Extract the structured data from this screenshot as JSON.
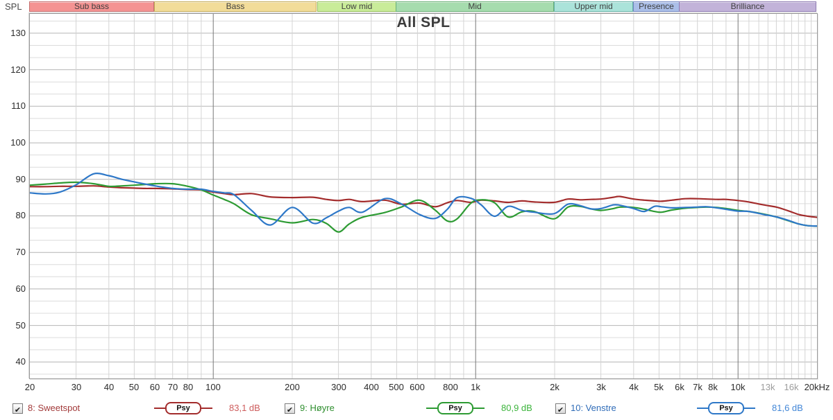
{
  "window": {
    "y_axis_corner_label": "SPL",
    "title": "All SPL"
  },
  "bands": {
    "items": [
      {
        "label": "Sub bass",
        "from": 20,
        "to": 60,
        "fill": "#f49392",
        "border": "#c4706f"
      },
      {
        "label": "Bass",
        "from": 60,
        "to": 250,
        "fill": "#f2dc99",
        "border": "#c3ab58"
      },
      {
        "label": "Low mid",
        "from": 250,
        "to": 500,
        "fill": "#c9ec99",
        "border": "#96c05b"
      },
      {
        "label": "Mid",
        "from": 500,
        "to": 2000,
        "fill": "#a6dcae",
        "border": "#69af77"
      },
      {
        "label": "Upper mid",
        "from": 2000,
        "to": 4000,
        "fill": "#abe3da",
        "border": "#66b2a6"
      },
      {
        "label": "Presence",
        "from": 4000,
        "to": 6000,
        "fill": "#abbfe8",
        "border": "#7288c2"
      },
      {
        "label": "Brilliance",
        "from": 6000,
        "to": 20000,
        "fill": "#c2b3d9",
        "border": "#8d7ab1"
      }
    ]
  },
  "chart_data": {
    "type": "line",
    "title": "All SPL",
    "ylabel": "SPL",
    "x_scale": "log",
    "xlim": [
      20,
      20000
    ],
    "ylim": [
      35.5,
      135.3
    ],
    "grid": true,
    "y_tick_values": [
      130,
      120,
      110,
      100,
      90,
      80,
      70,
      60,
      50,
      40
    ],
    "x_tick_labels": [
      {
        "f": 20,
        "label": "20"
      },
      {
        "f": 30,
        "label": "30"
      },
      {
        "f": 40,
        "label": "40"
      },
      {
        "f": 50,
        "label": "50"
      },
      {
        "f": 60,
        "label": "60"
      },
      {
        "f": 70,
        "label": "70"
      },
      {
        "f": 80,
        "label": "80"
      },
      {
        "f": 100,
        "label": "100"
      },
      {
        "f": 200,
        "label": "200"
      },
      {
        "f": 300,
        "label": "300"
      },
      {
        "f": 400,
        "label": "400"
      },
      {
        "f": 500,
        "label": "500"
      },
      {
        "f": 600,
        "label": "600"
      },
      {
        "f": 800,
        "label": "800"
      },
      {
        "f": 1000,
        "label": "1k"
      },
      {
        "f": 2000,
        "label": "2k"
      },
      {
        "f": 3000,
        "label": "3k"
      },
      {
        "f": 4000,
        "label": "4k"
      },
      {
        "f": 5000,
        "label": "5k"
      },
      {
        "f": 6000,
        "label": "6k"
      },
      {
        "f": 7000,
        "label": "7k"
      },
      {
        "f": 8000,
        "label": "8k"
      },
      {
        "f": 10000,
        "label": "10k"
      },
      {
        "f": 13000,
        "label": "13k",
        "muted": true
      },
      {
        "f": 16000,
        "label": "16k",
        "muted": true
      },
      {
        "f": 20000,
        "label": "20kHz"
      }
    ],
    "x_minor_gridlines": [
      30,
      40,
      50,
      60,
      70,
      80,
      90,
      200,
      300,
      400,
      500,
      600,
      700,
      800,
      900,
      2000,
      3000,
      4000,
      5000,
      6000,
      7000,
      8000,
      9000,
      11000,
      12000,
      13000,
      14000,
      15000,
      16000,
      17000,
      18000,
      19000
    ],
    "x_major_gridlines": [
      100,
      1000,
      10000
    ],
    "x": [
      20,
      23,
      26,
      30,
      35,
      40,
      45,
      50,
      55,
      60,
      70,
      80,
      90,
      100,
      110,
      120,
      140,
      165,
      200,
      240,
      270,
      300,
      330,
      370,
      450,
      520,
      610,
      700,
      780,
      850,
      960,
      1050,
      1180,
      1330,
      1500,
      1670,
      1990,
      2250,
      2500,
      2750,
      3000,
      3350,
      3550,
      4000,
      4400,
      4800,
      5100,
      5600,
      6300,
      7000,
      7600,
      8300,
      9000,
      10000,
      11000,
      12500,
      14000,
      15500,
      17000,
      18500,
      20000
    ],
    "series": [
      {
        "name": "8: Sweetspot",
        "color": "#a32c2c",
        "smoothing": "Psy",
        "avg": "83,1 dB",
        "y": [
          88.0,
          88.0,
          88.1,
          88.1,
          88.2,
          87.9,
          87.7,
          87.6,
          87.5,
          87.5,
          87.4,
          87.2,
          87.1,
          86.5,
          86.1,
          85.8,
          86.1,
          85.2,
          85.0,
          85.1,
          84.5,
          84.2,
          84.5,
          83.9,
          84.3,
          83.2,
          83.5,
          82.5,
          83.6,
          84.2,
          83.7,
          84.3,
          84.1,
          83.7,
          84.1,
          83.8,
          83.7,
          84.6,
          84.4,
          84.5,
          84.6,
          85.1,
          85.3,
          84.6,
          84.3,
          84.1,
          84.0,
          84.3,
          84.7,
          84.7,
          84.6,
          84.5,
          84.5,
          84.2,
          83.8,
          83.0,
          82.4,
          81.4,
          80.4,
          79.9,
          79.6
        ]
      },
      {
        "name": "9: Høyre",
        "color": "#2d9b33",
        "smoothing": "Psy",
        "avg": "80,9 dB",
        "y": [
          88.4,
          88.7,
          89.0,
          89.2,
          88.8,
          88.1,
          88.2,
          88.4,
          88.6,
          88.8,
          88.8,
          88.1,
          87.1,
          85.7,
          84.5,
          83.3,
          80.3,
          79.2,
          78.1,
          79.0,
          77.9,
          75.6,
          77.8,
          79.6,
          80.9,
          82.4,
          84.3,
          81.6,
          78.6,
          79.2,
          83.5,
          84.4,
          83.6,
          79.7,
          81.1,
          81.2,
          79.2,
          82.4,
          82.6,
          81.9,
          81.5,
          82.0,
          82.4,
          82.3,
          81.8,
          81.2,
          81.0,
          81.6,
          82.1,
          82.3,
          82.4,
          82.3,
          82.0,
          81.5,
          81.2,
          80.5,
          79.7,
          78.7,
          77.8,
          77.3,
          77.2
        ]
      },
      {
        "name": "10: Venstre",
        "color": "#2e78c8",
        "smoothing": "Psy",
        "avg": "81,6 dB",
        "y": [
          86.3,
          86.0,
          86.5,
          88.5,
          91.5,
          91.0,
          90.0,
          89.3,
          88.7,
          88.2,
          87.5,
          87.3,
          87.3,
          86.7,
          86.3,
          85.8,
          81.5,
          77.5,
          82.3,
          78.0,
          79.5,
          81.3,
          82.3,
          81.0,
          84.7,
          83.3,
          80.4,
          79.3,
          81.8,
          85.0,
          84.8,
          83.0,
          79.9,
          82.6,
          81.5,
          81.0,
          80.6,
          83.2,
          82.8,
          81.9,
          82.0,
          83.0,
          82.9,
          82.0,
          81.2,
          82.6,
          82.5,
          82.2,
          82.3,
          82.4,
          82.5,
          82.2,
          81.8,
          81.3,
          81.2,
          80.4,
          79.7,
          78.8,
          77.8,
          77.3,
          77.2
        ]
      }
    ]
  },
  "legend": {
    "items": [
      {
        "checked": true,
        "checkmark": "✔",
        "label": "8: Sweetspot",
        "badge": "Psy",
        "value": "83,1 dB",
        "label_color": "#a23a3a",
        "value_color": "#cd5c5c",
        "trace_color": "#a32c2c"
      },
      {
        "checked": true,
        "checkmark": "✔",
        "label": "9: Høyre",
        "badge": "Psy",
        "value": "80,9 dB",
        "label_color": "#2f8f2f",
        "value_color": "#3cb43c",
        "trace_color": "#2d9b33"
      },
      {
        "checked": true,
        "checkmark": "✔",
        "label": "10: Venstre",
        "badge": "Psy",
        "value": "81,6 dB",
        "label_color": "#2f6cb8",
        "value_color": "#4387d7",
        "trace_color": "#2e78c8"
      }
    ]
  }
}
